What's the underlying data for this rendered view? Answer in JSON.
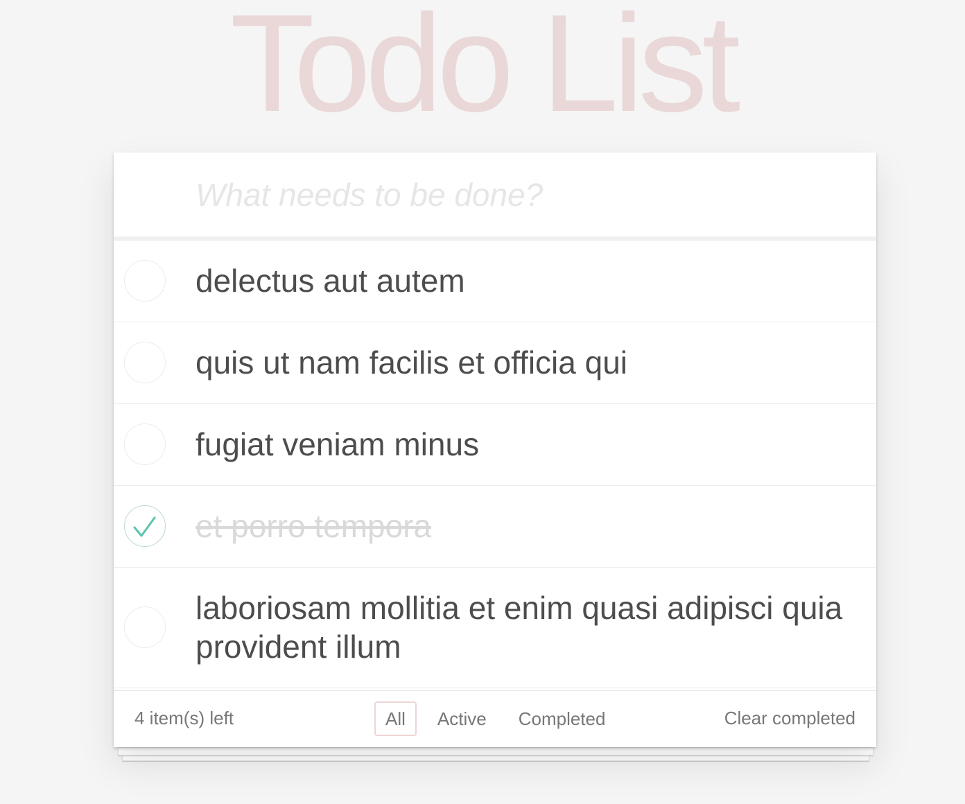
{
  "app": {
    "title": "Todo List"
  },
  "new_todo": {
    "placeholder": "What needs to be done?",
    "value": ""
  },
  "todos": [
    {
      "text": "delectus aut autem",
      "completed": false
    },
    {
      "text": "quis ut nam facilis et officia qui",
      "completed": false
    },
    {
      "text": "fugiat veniam minus",
      "completed": false
    },
    {
      "text": "et porro tempora",
      "completed": true
    },
    {
      "text": "laboriosam mollitia et enim quasi adipisci quia provident illum",
      "completed": false
    }
  ],
  "footer": {
    "count_text": "4 item(s) left",
    "filters": [
      {
        "label": "All",
        "selected": true
      },
      {
        "label": "Active",
        "selected": false
      },
      {
        "label": "Completed",
        "selected": false
      }
    ],
    "clear_label": "Clear completed"
  },
  "colors": {
    "title": "#eadada",
    "check": "#5dc2af",
    "check_border": "#bddad5",
    "selected_filter_border": "#eccfcf",
    "background": "#f5f5f5"
  },
  "icons": {
    "check": "check-icon"
  }
}
